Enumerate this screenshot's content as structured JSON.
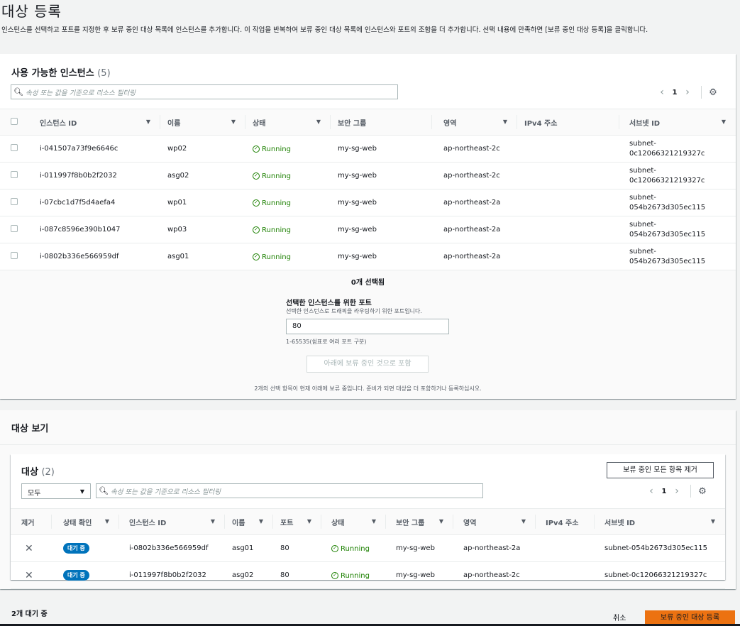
{
  "page": {
    "title": "대상 등록",
    "description": "인스턴스를 선택하고 포트를 지정한 후 보류 중인 대상 목록에 인스턴스를 추가합니다. 이 작업을 반복하여 보류 중인 대상 목록에 인스턴스와 포트의 조합을 더 추가합니다. 선택 내용에 만족하면 [보류 중인 대상 등록]을 클릭합니다."
  },
  "available": {
    "title": "사용 가능한 인스턴스",
    "count": "(5)",
    "search_placeholder": "속성 또는 값을 기준으로 리소스 필터링",
    "page": "1",
    "columns": [
      "인스턴스 ID",
      "이름",
      "상태",
      "보안 그룹",
      "영역",
      "IPv4 주소",
      "서브넷 ID"
    ],
    "rows": [
      {
        "id": "i-041507a73f9e6646c",
        "name": "wp02",
        "state": "Running",
        "sg": "my-sg-web",
        "zone": "ap-northeast-2c",
        "ipv4": "",
        "subnet1": "subnet-",
        "subnet2": "0c12066321219327c"
      },
      {
        "id": "i-011997f8b0b2f2032",
        "name": "asg02",
        "state": "Running",
        "sg": "my-sg-web",
        "zone": "ap-northeast-2c",
        "ipv4": "",
        "subnet1": "subnet-",
        "subnet2": "0c12066321219327c"
      },
      {
        "id": "i-07cbc1d7f5d4aefa4",
        "name": "wp01",
        "state": "Running",
        "sg": "my-sg-web",
        "zone": "ap-northeast-2a",
        "ipv4": "",
        "subnet1": "subnet-",
        "subnet2": "054b2673d305ec115"
      },
      {
        "id": "i-087c8596e390b1047",
        "name": "wp03",
        "state": "Running",
        "sg": "my-sg-web",
        "zone": "ap-northeast-2a",
        "ipv4": "",
        "subnet1": "subnet-",
        "subnet2": "054b2673d305ec115"
      },
      {
        "id": "i-0802b336e566959df",
        "name": "asg01",
        "state": "Running",
        "sg": "my-sg-web",
        "zone": "ap-northeast-2a",
        "ipv4": "",
        "subnet1": "subnet-",
        "subnet2": "054b2673d305ec115"
      }
    ],
    "selected_text": "0개 선택됨",
    "port_label": "선택한 인스턴스를 위한 포트",
    "port_desc": "선택한 인스턴스로 트래픽을 라우팅하기 위한 포트입니다.",
    "port_value": "80",
    "port_hint": "1-65535(쉼표로 여러 포트 구분)",
    "include_button": "아래에 보류 중인 것으로 포함",
    "notice": "2개의 선택 항목이 현재 아래에 보류 중입니다. 준비가 되면 대상을 더 포함하거나 등록하십시오."
  },
  "review": {
    "title": "대상 보기",
    "targets_title": "대상",
    "targets_count": "(2)",
    "remove_all_button": "보류 중인 모든 항목 제거",
    "filter_select": "모두",
    "search_placeholder": "속성 또는 값을 기준으로 리소스 필터링",
    "page": "1",
    "columns": [
      "제거",
      "상태 확인",
      "인스턴스 ID",
      "이름",
      "포트",
      "상태",
      "보안 그룹",
      "영역",
      "IPv4 주소",
      "서브넷 ID"
    ],
    "rows": [
      {
        "health": "대기 중",
        "id": "i-0802b336e566959df",
        "name": "asg01",
        "port": "80",
        "state": "Running",
        "sg": "my-sg-web",
        "zone": "ap-northeast-2a",
        "ipv4": "",
        "subnet": "subnet-054b2673d305ec115"
      },
      {
        "health": "대기 중",
        "id": "i-011997f8b0b2f2032",
        "name": "asg02",
        "port": "80",
        "state": "Running",
        "sg": "my-sg-web",
        "zone": "ap-northeast-2c",
        "ipv4": "",
        "subnet": "subnet-0c12066321219327c"
      }
    ]
  },
  "footer": {
    "pending_text": "2개 대기 중",
    "cancel": "취소",
    "register": "보류 중인 대상 등록"
  },
  "colors": {
    "accent": "#ec7211",
    "running": "#1d8102",
    "badge": "#0073bb"
  }
}
